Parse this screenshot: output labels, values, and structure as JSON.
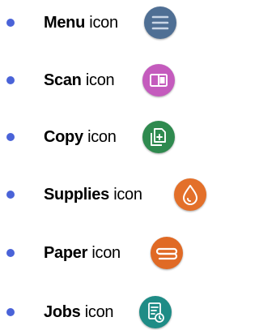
{
  "items": [
    {
      "name": "Menu",
      "suffix": "icon",
      "icon": "menu-icon",
      "color": "#4f6f94"
    },
    {
      "name": "Scan",
      "suffix": "icon",
      "icon": "scan-icon",
      "color": "#c45bbd"
    },
    {
      "name": "Copy",
      "suffix": "icon",
      "icon": "copy-icon",
      "color": "#2f8a4f"
    },
    {
      "name": "Supplies",
      "suffix": "icon",
      "icon": "supplies-icon",
      "color": "#e3702a"
    },
    {
      "name": "Paper",
      "suffix": "icon",
      "icon": "paper-icon",
      "color": "#e06a25"
    },
    {
      "name": "Jobs",
      "suffix": "icon",
      "icon": "jobs-icon",
      "color": "#1f8c86"
    }
  ],
  "bullet_color": "#4a63d8"
}
